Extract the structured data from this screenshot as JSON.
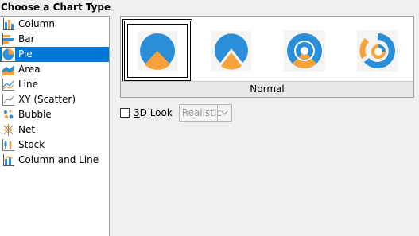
{
  "heading": "Choose a Chart Type",
  "chart_types": [
    {
      "label": "Column",
      "icon": "column-chart-icon"
    },
    {
      "label": "Bar",
      "icon": "bar-chart-icon"
    },
    {
      "label": "Pie",
      "icon": "pie-chart-icon",
      "selected": true
    },
    {
      "label": "Area",
      "icon": "area-chart-icon"
    },
    {
      "label": "Line",
      "icon": "line-chart-icon"
    },
    {
      "label": "XY (Scatter)",
      "icon": "scatter-chart-icon"
    },
    {
      "label": "Bubble",
      "icon": "bubble-chart-icon"
    },
    {
      "label": "Net",
      "icon": "net-chart-icon"
    },
    {
      "label": "Stock",
      "icon": "stock-chart-icon"
    },
    {
      "label": "Column and Line",
      "icon": "column-and-line-chart-icon"
    }
  ],
  "variants": {
    "selected_name": "Normal",
    "items": [
      "pie-normal-icon",
      "pie-exploded-icon",
      "donut-icon",
      "donut-exploded-icon"
    ]
  },
  "look": {
    "checkbox_label_prefix": "",
    "checkbox_label_underlined": "3",
    "checkbox_label_rest": "D Look",
    "checked": false,
    "select_value": "Realistic"
  },
  "colors": {
    "selection": "#0078d7",
    "pie_blue": "#2a8fd8",
    "pie_orange": "#f7a13b"
  }
}
